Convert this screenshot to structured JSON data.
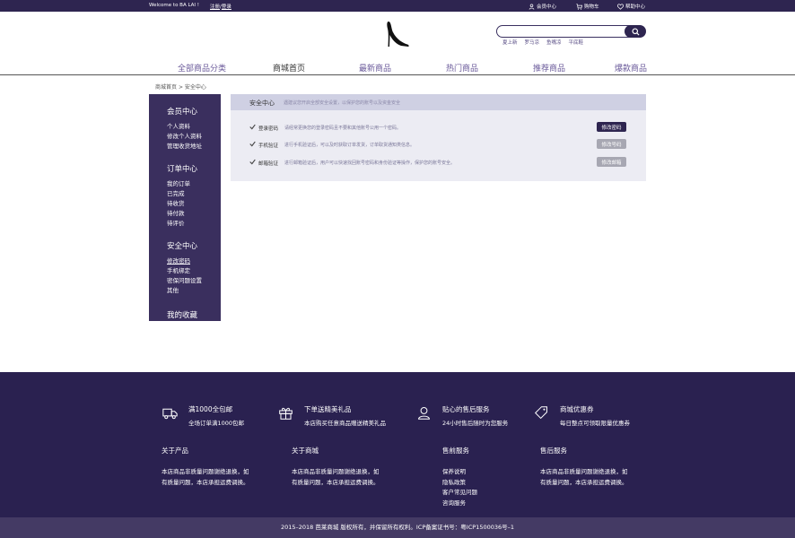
{
  "topbar": {
    "welcome": "Welcome to BA LAI !",
    "register": "注册",
    "separator": "/",
    "login": "登录",
    "member_center": "会员中心",
    "cart": "购物车",
    "help_center": "帮助中心"
  },
  "search": {
    "placeholder": "",
    "hot_words": [
      "夏上新",
      "罗马凉",
      "鱼嘴凉",
      "平底鞋"
    ]
  },
  "nav": {
    "items": [
      "全部商品分类",
      "商城首页",
      "最新商品",
      "热门商品",
      "推荐商品",
      "爆款商品"
    ],
    "active": "商城首页"
  },
  "breadcrumb": {
    "home": "商城首页",
    "sep": ">",
    "current": "安全中心"
  },
  "sidebar": {
    "sections": [
      {
        "title": "会员中心",
        "items": [
          "个人资料",
          "修改个人资料",
          "管理收货地址"
        ]
      },
      {
        "title": "订单中心",
        "items": [
          "我的订单",
          "已完成",
          "待收货",
          "待付款",
          "待评价"
        ]
      },
      {
        "title": "安全中心",
        "items": [
          "修改密码",
          "手机绑定",
          "密保问题设置",
          "其他"
        ]
      },
      {
        "title": "我的收藏",
        "items": []
      }
    ],
    "selected": "修改密码"
  },
  "security": {
    "title": "安全中心",
    "subtitle": "遇建议您开启全部安全设置，以保护您的账号以及资金安全",
    "rows": [
      {
        "label": "登录密码",
        "desc": "请经常更换您的登录密码且不要和其他账号公用一个密码。",
        "button": "修改密码",
        "button_style": "dark"
      },
      {
        "label": "手机验证",
        "desc": "进行手机验证后，可以及时获取订单发货，订单取货通知类信息。",
        "button": "修改号码",
        "button_style": "gray"
      },
      {
        "label": "邮箱验证",
        "desc": "进行邮箱验证后，用户可以快速找回账号密码和身份验证等操作，保护您的账号安全。",
        "button": "修改邮箱",
        "button_style": "gray"
      }
    ]
  },
  "footer": {
    "features": [
      {
        "icon": "truck-icon",
        "title": "满1000全包邮",
        "sub": "全场订单满1000包邮"
      },
      {
        "icon": "gift-icon",
        "title": "下单送精美礼品",
        "sub": "本店购买任意商品赠送精美礼品"
      },
      {
        "icon": "support-icon",
        "title": "贴心的售后服务",
        "sub": "24小时售后随时为您服务"
      },
      {
        "icon": "coupon-icon",
        "title": "商城优惠券",
        "sub": "每日整点可领取限量优惠券"
      }
    ],
    "columns": [
      {
        "title": "关于产品",
        "lines": [
          "本店商品非质量问题谢绝退换，如",
          "有质量问题，本店承担运费调换。"
        ]
      },
      {
        "title": "关于商城",
        "lines": [
          "本店商品非质量问题谢绝退换，如",
          "有质量问题，本店承担运费调换。"
        ]
      },
      {
        "title": "售前服务",
        "lines": [
          "保养说明",
          "隐私政策",
          "客户常见问题",
          "咨询服务"
        ]
      },
      {
        "title": "售后服务",
        "lines": [
          "本店商品非质量问题谢绝退换，如",
          "有质量问题，本店承担运费调换。"
        ]
      }
    ],
    "copyright": "2015–2018 芭莱商城 版权所有，并保留所有权利。ICP备案证书号：粤ICP1500036号–1"
  },
  "colors": {
    "brand": "#2e2550",
    "panel_head": "#cfd0e3",
    "nav_text": "#6a5a9a"
  }
}
